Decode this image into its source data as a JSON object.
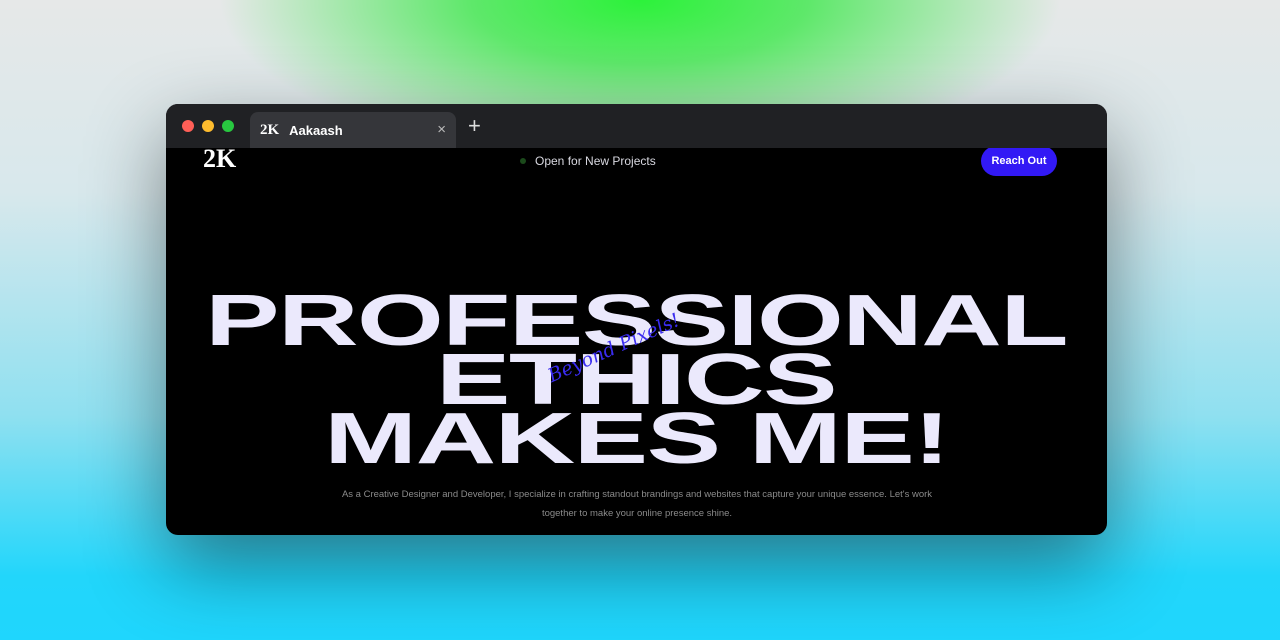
{
  "browser": {
    "tab_title": "Aakaash",
    "tab_favicon": "2K",
    "new_tab": "+",
    "close": "×",
    "traffic_lights": {
      "close": "#ff5f57",
      "minimize": "#febc2e",
      "maximize": "#28c840"
    }
  },
  "site": {
    "logo": "2K",
    "status": "Open for New Projects",
    "cta": "Reach Out",
    "headline": [
      "PROFESSIONAL",
      "ETHICS",
      "MAKES ME!"
    ],
    "signature": "Beyond Pixels!",
    "description": "As a Creative Designer and Developer, I specialize in crafting standout brandings and websites that capture your unique essence. Let's work together to make your online presence shine.",
    "accent": "#3219f5"
  }
}
